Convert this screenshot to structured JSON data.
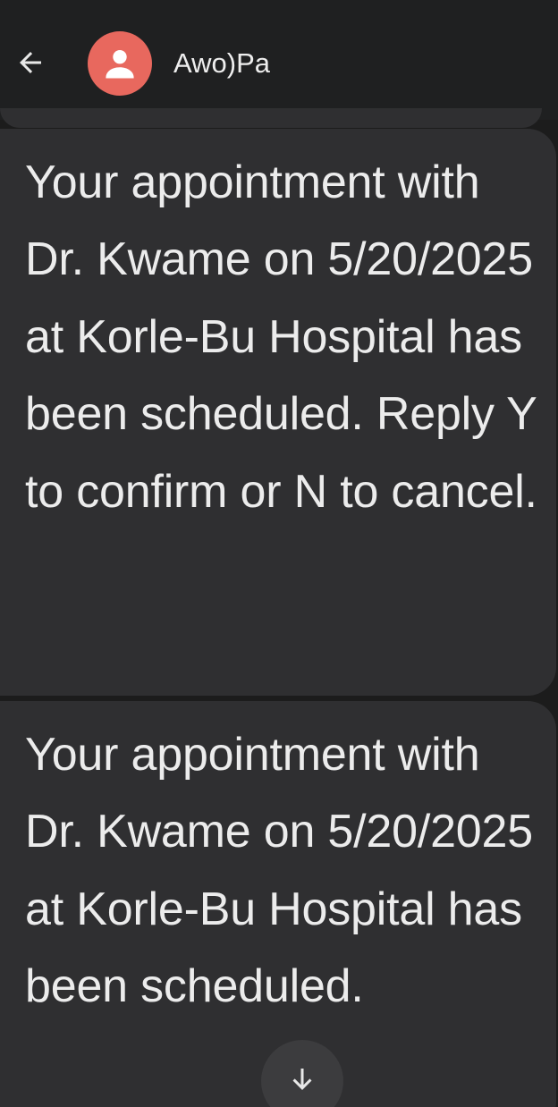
{
  "header": {
    "contact_name": "Awo)Pa",
    "back_icon": "arrow-left-icon",
    "avatar_icon": "person-icon",
    "avatar_color": "#e8685e"
  },
  "messages": [
    {
      "text": "Your appointment with Dr. Kwame on 5/20/2025 at Korle-Bu Hospital has been scheduled. Reply Y to confirm or N to cancel."
    },
    {
      "text": "Your appointment with Dr. Kwame on 5/20/2025 at Korle-Bu Hospital has been scheduled."
    }
  ],
  "scroll_button": {
    "icon": "arrow-down-icon"
  }
}
